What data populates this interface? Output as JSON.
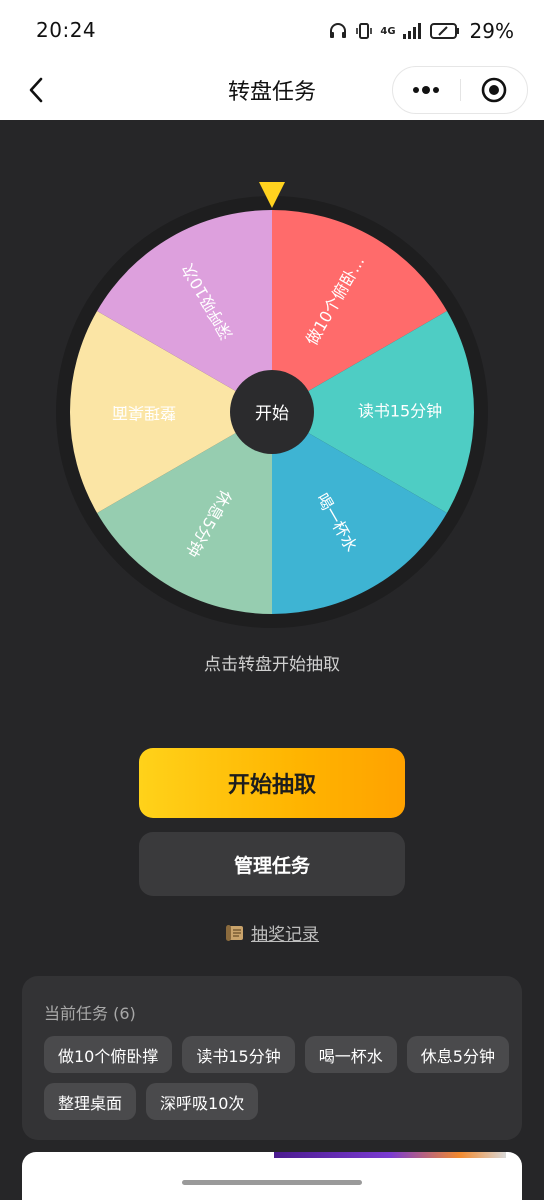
{
  "status_bar": {
    "time": "20:24",
    "network": "4G",
    "battery": "29%"
  },
  "nav": {
    "title": "转盘任务",
    "back_icon": "chevron-left-icon",
    "more_icon": "more-dots-icon",
    "close_icon": "target-circle-icon"
  },
  "wheel": {
    "center_label": "开始",
    "pointer_color": "#ffd21f",
    "segments": [
      {
        "label": "做10个俯卧...",
        "color": "#ff6b6b"
      },
      {
        "label": "读书15分钟",
        "color": "#4ecdc4"
      },
      {
        "label": "喝一杯水",
        "color": "#3eb4d3"
      },
      {
        "label": "休息5分钟",
        "color": "#96cdb0"
      },
      {
        "label": "整理桌面",
        "color": "#fbe5a5"
      },
      {
        "label": "深呼吸10次",
        "color": "#dda0dd"
      }
    ]
  },
  "hint": "点击转盘开始抽取",
  "buttons": {
    "start": "开始抽取",
    "manage": "管理任务",
    "history": "抽奖记录",
    "history_icon": "scroll-icon"
  },
  "tasks": {
    "title": "当前任务 (6)",
    "items": [
      "做10个俯卧撑",
      "读书15分钟",
      "喝一杯水",
      "休息5分钟",
      "整理桌面",
      "深呼吸10次"
    ]
  },
  "colors": {
    "accent": "#ffb400",
    "background": "#262628"
  }
}
